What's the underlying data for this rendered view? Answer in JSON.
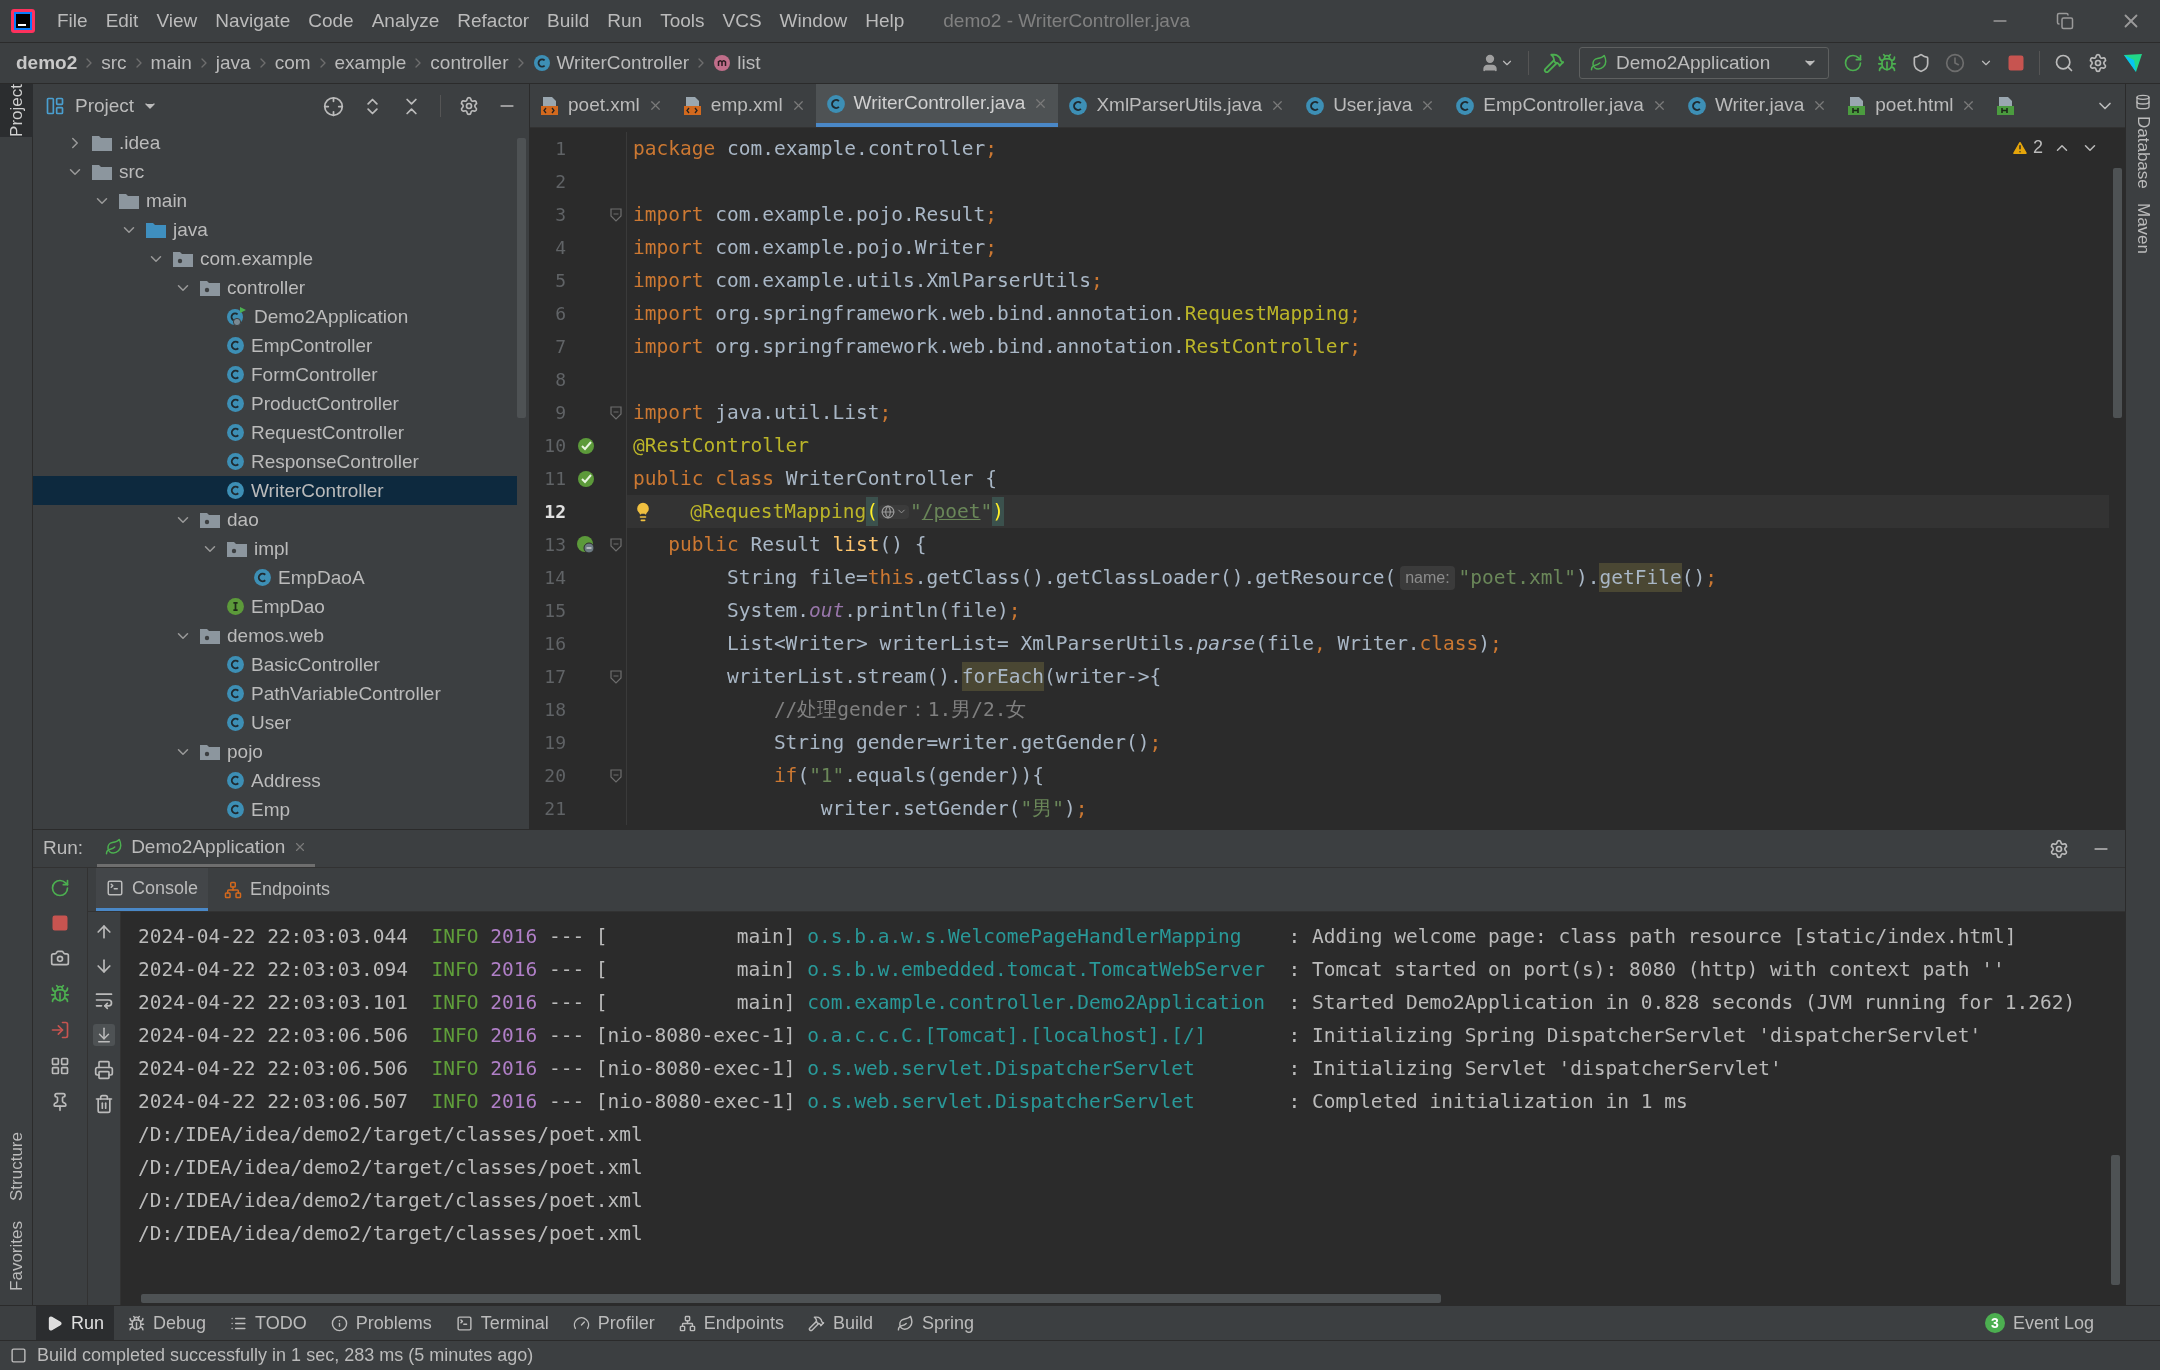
{
  "menu": {
    "items": [
      "File",
      "Edit",
      "View",
      "Navigate",
      "Code",
      "Analyze",
      "Refactor",
      "Build",
      "Run",
      "Tools",
      "VCS",
      "Window",
      "Help"
    ],
    "title": "demo2 - WriterController.java"
  },
  "breadcrumbs": [
    {
      "label": "demo2",
      "kind": "project"
    },
    {
      "label": "src",
      "kind": "dir"
    },
    {
      "label": "main",
      "kind": "dir"
    },
    {
      "label": "java",
      "kind": "dir"
    },
    {
      "label": "com",
      "kind": "dir"
    },
    {
      "label": "example",
      "kind": "dir"
    },
    {
      "label": "controller",
      "kind": "dir"
    },
    {
      "label": "WriterController",
      "kind": "class"
    },
    {
      "label": "list",
      "kind": "method"
    }
  ],
  "run_config": "Demo2Application",
  "side_tabs": {
    "left_top": [
      {
        "label": "Project",
        "selected": true
      }
    ],
    "left_bottom": [
      {
        "label": "Structure",
        "selected": false
      },
      {
        "label": "Favorites",
        "selected": false
      }
    ],
    "right": [
      {
        "label": "Database",
        "selected": false
      },
      {
        "label": "Maven",
        "selected": false
      }
    ]
  },
  "project_panel": {
    "title": "Project",
    "tree": [
      {
        "label": ".idea",
        "kind": "folder",
        "expanded": false,
        "selected": false
      },
      {
        "label": "src",
        "kind": "folder",
        "expanded": true,
        "selected": false,
        "children": [
          {
            "label": "main",
            "kind": "folder",
            "expanded": true,
            "selected": false,
            "children": [
              {
                "label": "java",
                "kind": "source-folder",
                "expanded": true,
                "selected": false,
                "children": [
                  {
                    "label": "com.example",
                    "kind": "package",
                    "expanded": true,
                    "selected": false,
                    "children": [
                      {
                        "label": "controller",
                        "kind": "package",
                        "expanded": true,
                        "selected": false,
                        "children": [
                          {
                            "label": "Demo2Application",
                            "kind": "spring-class",
                            "selected": false
                          },
                          {
                            "label": "EmpController",
                            "kind": "class",
                            "selected": false
                          },
                          {
                            "label": "FormController",
                            "kind": "class",
                            "selected": false
                          },
                          {
                            "label": "ProductController",
                            "kind": "class",
                            "selected": false
                          },
                          {
                            "label": "RequestController",
                            "kind": "class",
                            "selected": false
                          },
                          {
                            "label": "ResponseController",
                            "kind": "class",
                            "selected": false
                          },
                          {
                            "label": "WriterController",
                            "kind": "class",
                            "selected": true
                          }
                        ]
                      },
                      {
                        "label": "dao",
                        "kind": "package",
                        "expanded": true,
                        "selected": false,
                        "children": [
                          {
                            "label": "impl",
                            "kind": "package",
                            "expanded": true,
                            "selected": false,
                            "children": [
                              {
                                "label": "EmpDaoA",
                                "kind": "class",
                                "selected": false
                              }
                            ]
                          },
                          {
                            "label": "EmpDao",
                            "kind": "interface",
                            "selected": false
                          }
                        ]
                      },
                      {
                        "label": "demos.web",
                        "kind": "package",
                        "expanded": true,
                        "selected": false,
                        "children": [
                          {
                            "label": "BasicController",
                            "kind": "class",
                            "selected": false
                          },
                          {
                            "label": "PathVariableController",
                            "kind": "class",
                            "selected": false
                          },
                          {
                            "label": "User",
                            "kind": "class",
                            "selected": false
                          }
                        ]
                      },
                      {
                        "label": "pojo",
                        "kind": "package",
                        "expanded": true,
                        "selected": false,
                        "children": [
                          {
                            "label": "Address",
                            "kind": "class",
                            "selected": false
                          },
                          {
                            "label": "Emp",
                            "kind": "class",
                            "selected": false
                          }
                        ]
                      }
                    ]
                  }
                ]
              }
            ]
          }
        ]
      }
    ]
  },
  "editor": {
    "tabs": [
      {
        "label": "poet.xml",
        "kind": "xml",
        "selected": false
      },
      {
        "label": "emp.xml",
        "kind": "xml",
        "selected": false
      },
      {
        "label": "WriterController.java",
        "kind": "java",
        "selected": true
      },
      {
        "label": "XmlParserUtils.java",
        "kind": "java",
        "selected": false
      },
      {
        "label": "User.java",
        "kind": "java",
        "selected": false
      },
      {
        "label": "EmpController.java",
        "kind": "java",
        "selected": false
      },
      {
        "label": "Writer.java",
        "kind": "java",
        "selected": false
      },
      {
        "label": "poet.html",
        "kind": "html",
        "selected": false
      },
      {
        "kind": "html",
        "selected": false
      }
    ],
    "warnings": "2",
    "lines": [
      {
        "n": "1",
        "current": false,
        "fold": false,
        "tokens": [
          {
            "kind": "kw",
            "text": "package"
          },
          {
            "kind": "plain",
            "text": " com.example.controller"
          },
          {
            "kind": "kw",
            "text": ";"
          }
        ]
      },
      {
        "n": "2",
        "current": false,
        "fold": false
      },
      {
        "n": "3",
        "current": false,
        "fold": true,
        "tokens": [
          {
            "kind": "kw",
            "text": "import"
          },
          {
            "kind": "plain",
            "text": " com.example.pojo.Result"
          },
          {
            "kind": "kw",
            "text": ";"
          }
        ]
      },
      {
        "n": "4",
        "current": false,
        "fold": false,
        "tokens": [
          {
            "kind": "kw",
            "text": "import"
          },
          {
            "kind": "plain",
            "text": " com.example.pojo.Writer"
          },
          {
            "kind": "kw",
            "text": ";"
          }
        ]
      },
      {
        "n": "5",
        "current": false,
        "fold": false,
        "tokens": [
          {
            "kind": "kw",
            "text": "import"
          },
          {
            "kind": "plain",
            "text": " com.example.utils.XmlParserUtils"
          },
          {
            "kind": "kw",
            "text": ";"
          }
        ]
      },
      {
        "n": "6",
        "current": false,
        "fold": false,
        "tokens": [
          {
            "kind": "kw",
            "text": "import"
          },
          {
            "kind": "plain",
            "text": " org.springframework.web.bind.annotation."
          },
          {
            "kind": "ann",
            "text": "RequestMapping"
          },
          {
            "kind": "kw",
            "text": ";"
          }
        ]
      },
      {
        "n": "7",
        "current": false,
        "fold": false,
        "tokens": [
          {
            "kind": "kw",
            "text": "import"
          },
          {
            "kind": "plain",
            "text": " org.springframework.web.bind.annotation."
          },
          {
            "kind": "ann",
            "text": "RestController"
          },
          {
            "kind": "kw",
            "text": ";"
          }
        ]
      },
      {
        "n": "8",
        "current": false,
        "fold": false
      },
      {
        "n": "9",
        "current": false,
        "fold": true,
        "tokens": [
          {
            "kind": "kw",
            "text": "import"
          },
          {
            "kind": "plain",
            "text": " java.util.List"
          },
          {
            "kind": "kw",
            "text": ";"
          }
        ]
      },
      {
        "n": "10",
        "current": false,
        "fold": false,
        "gutter": {
          "kind": "bean"
        },
        "tokens": [
          {
            "kind": "ann",
            "text": "@RestController"
          }
        ]
      },
      {
        "n": "11",
        "current": false,
        "fold": false,
        "gutter": {
          "kind": "bean"
        },
        "tokens": [
          {
            "kind": "kw",
            "text": "public class "
          },
          {
            "kind": "plain",
            "text": "WriterController {"
          }
        ]
      },
      {
        "n": "12",
        "current": true,
        "fold": false,
        "bulb": true,
        "tokens": [
          {
            "kind": "ann",
            "text": "   @RequestMapping"
          },
          {
            "kind": "brace",
            "text": "("
          },
          {
            "kind": "url-inlay"
          },
          {
            "kind": "str",
            "text": "\""
          },
          {
            "kind": "link",
            "text": "/poet"
          },
          {
            "kind": "str",
            "text": "\""
          },
          {
            "kind": "brace",
            "text": ")"
          }
        ]
      },
      {
        "n": "13",
        "current": false,
        "fold": true,
        "gutter": {
          "kind": "endpoint"
        },
        "tokens": [
          {
            "kind": "kw",
            "text": "   public "
          },
          {
            "kind": "plain",
            "text": "Result "
          },
          {
            "kind": "fn",
            "text": "list"
          },
          {
            "kind": "plain",
            "text": "() {"
          }
        ]
      },
      {
        "n": "14",
        "current": false,
        "fold": false,
        "tokens": [
          {
            "kind": "plain",
            "text": "        String file="
          },
          {
            "kind": "kw",
            "text": "this"
          },
          {
            "kind": "plain",
            "text": ".getClass().getClassLoader().getResource("
          },
          {
            "kind": "hint",
            "text": "name:"
          },
          {
            "kind": "str",
            "text": "\"poet.xml\""
          },
          {
            "kind": "plain",
            "text": ")."
          },
          {
            "kind": "usage",
            "text": "getFile"
          },
          {
            "kind": "plain",
            "text": "()"
          },
          {
            "kind": "kw",
            "text": ";"
          }
        ]
      },
      {
        "n": "15",
        "current": false,
        "fold": false,
        "tokens": [
          {
            "kind": "plain",
            "text": "        System."
          },
          {
            "kind": "field",
            "text": "out"
          },
          {
            "kind": "plain",
            "text": ".println(file)"
          },
          {
            "kind": "kw",
            "text": ";"
          }
        ]
      },
      {
        "n": "16",
        "current": false,
        "fold": false,
        "tokens": [
          {
            "kind": "plain",
            "text": "        List<Writer> writerList= XmlParserUtils."
          },
          {
            "kind": "italic",
            "text": "parse"
          },
          {
            "kind": "plain",
            "text": "(file"
          },
          {
            "kind": "kw",
            "text": ","
          },
          {
            "kind": "plain",
            "text": " Writer."
          },
          {
            "kind": "kw",
            "text": "class"
          },
          {
            "kind": "plain",
            "text": ")"
          },
          {
            "kind": "kw",
            "text": ";"
          }
        ]
      },
      {
        "n": "17",
        "current": false,
        "fold": true,
        "tokens": [
          {
            "kind": "plain",
            "text": "        writerList.stream()."
          },
          {
            "kind": "usage",
            "text": "forEach"
          },
          {
            "kind": "plain",
            "text": "(writer->{"
          }
        ]
      },
      {
        "n": "18",
        "current": false,
        "fold": false,
        "tokens": [
          {
            "kind": "comment",
            "text": "            //处理gender：1.男/2.女"
          }
        ]
      },
      {
        "n": "19",
        "current": false,
        "fold": false,
        "tokens": [
          {
            "kind": "plain",
            "text": "            String gender=writer.getGender()"
          },
          {
            "kind": "kw",
            "text": ";"
          }
        ]
      },
      {
        "n": "20",
        "current": false,
        "fold": true,
        "tokens": [
          {
            "kind": "kw",
            "text": "            if"
          },
          {
            "kind": "plain",
            "text": "("
          },
          {
            "kind": "str",
            "text": "\"1\""
          },
          {
            "kind": "plain",
            "text": ".equals(gender)){"
          }
        ]
      },
      {
        "n": "21",
        "current": false,
        "fold": false,
        "tokens": [
          {
            "kind": "plain",
            "text": "                writer.setGender("
          },
          {
            "kind": "str",
            "text": "\"男\""
          },
          {
            "kind": "plain",
            "text": ")"
          },
          {
            "kind": "kw",
            "text": ";"
          }
        ]
      }
    ]
  },
  "run_panel": {
    "label": "Run:",
    "tab": "Demo2Application",
    "subtabs": [
      {
        "label": "Console",
        "selected": true
      },
      {
        "label": "Endpoints",
        "selected": false
      }
    ],
    "console": [
      [
        {
          "kind": "text",
          "text": "2024-04-22 22:03:03.044  "
        },
        {
          "kind": "level",
          "text": "INFO"
        },
        {
          "kind": "pid",
          "text": " 2016"
        },
        {
          "kind": "text",
          "text": " --- [           main] "
        },
        {
          "kind": "logger",
          "text": "o.s.b.a.w.s.WelcomePageHandlerMapping"
        },
        {
          "kind": "text",
          "text": " : Adding welcome page: class path resource [static/index.html]"
        }
      ],
      [
        {
          "kind": "text",
          "text": "2024-04-22 22:03:03.094  "
        },
        {
          "kind": "level",
          "text": "INFO"
        },
        {
          "kind": "pid",
          "text": " 2016"
        },
        {
          "kind": "text",
          "text": " --- [           main] "
        },
        {
          "kind": "logger",
          "text": "o.s.b.w.embedded.tomcat.TomcatWebServer"
        },
        {
          "kind": "text",
          "text": " : Tomcat started on port(s): 8080 (http) with context path ''"
        }
      ],
      [
        {
          "kind": "text",
          "text": "2024-04-22 22:03:03.101  "
        },
        {
          "kind": "level",
          "text": "INFO"
        },
        {
          "kind": "pid",
          "text": " 2016"
        },
        {
          "kind": "text",
          "text": " --- [           main] "
        },
        {
          "kind": "logger",
          "text": "com.example.controller.Demo2Application"
        },
        {
          "kind": "text",
          "text": " : Started Demo2Application in 0.828 seconds (JVM running for 1.262)"
        }
      ],
      [
        {
          "kind": "text",
          "text": "2024-04-22 22:03:06.506  "
        },
        {
          "kind": "level",
          "text": "INFO"
        },
        {
          "kind": "pid",
          "text": " 2016"
        },
        {
          "kind": "text",
          "text": " --- [nio-8080-exec-1] "
        },
        {
          "kind": "logger",
          "text": "o.a.c.c.C.[Tomcat].[localhost].[/]"
        },
        {
          "kind": "text",
          "text": " : Initializing Spring DispatcherServlet 'dispatcherServlet'"
        }
      ],
      [
        {
          "kind": "text",
          "text": "2024-04-22 22:03:06.506  "
        },
        {
          "kind": "level",
          "text": "INFO"
        },
        {
          "kind": "pid",
          "text": " 2016"
        },
        {
          "kind": "text",
          "text": " --- [nio-8080-exec-1] "
        },
        {
          "kind": "logger",
          "text": "o.s.web.servlet.DispatcherServlet"
        },
        {
          "kind": "text",
          "text": " : Initializing Servlet 'dispatcherServlet'"
        }
      ],
      [
        {
          "kind": "text",
          "text": "2024-04-22 22:03:06.507  "
        },
        {
          "kind": "level",
          "text": "INFO"
        },
        {
          "kind": "pid",
          "text": " 2016"
        },
        {
          "kind": "text",
          "text": " --- [nio-8080-exec-1] "
        },
        {
          "kind": "logger",
          "text": "o.s.web.servlet.DispatcherServlet"
        },
        {
          "kind": "text",
          "text": " : Completed initialization in 1 ms"
        }
      ],
      [
        {
          "kind": "text",
          "text": "/D:/IDEA/idea/demo2/target/classes/poet.xml"
        }
      ],
      [
        {
          "kind": "text",
          "text": "/D:/IDEA/idea/demo2/target/classes/poet.xml"
        }
      ],
      [
        {
          "kind": "text",
          "text": "/D:/IDEA/idea/demo2/target/classes/poet.xml"
        }
      ],
      [
        {
          "kind": "text",
          "text": "/D:/IDEA/idea/demo2/target/classes/poet.xml"
        }
      ]
    ]
  },
  "tool_tabs": [
    {
      "label": "Run",
      "selected": true
    },
    {
      "label": "Debug",
      "selected": false
    },
    {
      "label": "TODO",
      "selected": false
    },
    {
      "label": "Problems",
      "selected": false
    },
    {
      "label": "Terminal",
      "selected": false
    },
    {
      "label": "Profiler",
      "selected": false
    },
    {
      "label": "Endpoints",
      "selected": false
    },
    {
      "label": "Build",
      "selected": false
    },
    {
      "label": "Spring",
      "selected": false
    }
  ],
  "event_log": {
    "count": "3",
    "label": "Event Log"
  },
  "status": "Build completed successfully in 1 sec, 283 ms (5 minutes ago)"
}
